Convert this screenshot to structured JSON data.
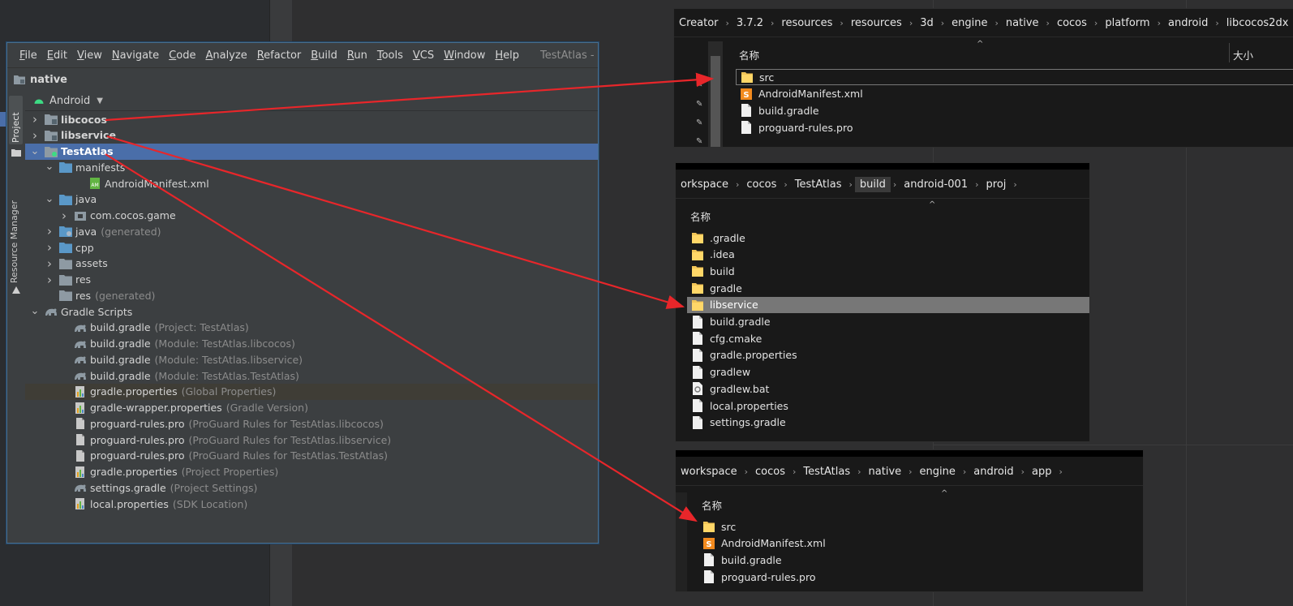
{
  "studio": {
    "menus": [
      "File",
      "Edit",
      "View",
      "Navigate",
      "Code",
      "Analyze",
      "Refactor",
      "Build",
      "Run",
      "Tools",
      "VCS",
      "Window",
      "Help"
    ],
    "window_title": "TestAtlas - libse",
    "breadcrumb": "native",
    "sidebar": {
      "project_tab": "Project",
      "resource_tab": "Resource Manager"
    },
    "view_selector": "Android",
    "tree": [
      {
        "label": "libcocos",
        "hint": "",
        "chevron": ">",
        "icon": "module",
        "bold": true,
        "indent": 0
      },
      {
        "label": "libservice",
        "hint": "",
        "chevron": ">",
        "icon": "module",
        "bold": true,
        "indent": 0
      },
      {
        "label": "TestAtlas",
        "hint": "",
        "chevron": "v",
        "icon": "app-module",
        "bold": true,
        "indent": 0,
        "selected": true
      },
      {
        "label": "manifests",
        "hint": "",
        "chevron": "v",
        "icon": "folder-blue",
        "bold": false,
        "indent": 1
      },
      {
        "label": "AndroidManifest.xml",
        "hint": "",
        "chevron": "",
        "icon": "manifest",
        "bold": false,
        "indent": 3
      },
      {
        "label": "java",
        "hint": "",
        "chevron": "v",
        "icon": "folder-blue",
        "bold": false,
        "indent": 1
      },
      {
        "label": "com.cocos.game",
        "hint": "",
        "chevron": ">",
        "icon": "package",
        "bold": false,
        "indent": 2
      },
      {
        "label": "java",
        "hint": "(generated)",
        "chevron": ">",
        "icon": "folder-gen",
        "bold": false,
        "indent": 1
      },
      {
        "label": "cpp",
        "hint": "",
        "chevron": ">",
        "icon": "folder-blue",
        "bold": false,
        "indent": 1
      },
      {
        "label": "assets",
        "hint": "",
        "chevron": ">",
        "icon": "folder",
        "bold": false,
        "indent": 1
      },
      {
        "label": "res",
        "hint": "",
        "chevron": ">",
        "icon": "folder",
        "bold": false,
        "indent": 1
      },
      {
        "label": "res",
        "hint": "(generated)",
        "chevron": "",
        "icon": "folder",
        "bold": false,
        "indent": 1
      },
      {
        "label": "Gradle Scripts",
        "hint": "",
        "chevron": "v",
        "icon": "gradle",
        "bold": false,
        "indent": 0
      },
      {
        "label": "build.gradle",
        "hint": "(Project: TestAtlas)",
        "chevron": "",
        "icon": "gradle",
        "bold": false,
        "indent": 2
      },
      {
        "label": "build.gradle",
        "hint": "(Module: TestAtlas.libcocos)",
        "chevron": "",
        "icon": "gradle",
        "bold": false,
        "indent": 2
      },
      {
        "label": "build.gradle",
        "hint": "(Module: TestAtlas.libservice)",
        "chevron": "",
        "icon": "gradle",
        "bold": false,
        "indent": 2
      },
      {
        "label": "build.gradle",
        "hint": "(Module: TestAtlas.TestAtlas)",
        "chevron": "",
        "icon": "gradle",
        "bold": false,
        "indent": 2
      },
      {
        "label": "gradle.properties",
        "hint": "(Global Properties)",
        "chevron": "",
        "icon": "props",
        "bold": false,
        "indent": 2,
        "hilite": true
      },
      {
        "label": "gradle-wrapper.properties",
        "hint": "(Gradle Version)",
        "chevron": "",
        "icon": "props",
        "bold": false,
        "indent": 2
      },
      {
        "label": "proguard-rules.pro",
        "hint": "(ProGuard Rules for TestAtlas.libcocos)",
        "chevron": "",
        "icon": "file",
        "bold": false,
        "indent": 2
      },
      {
        "label": "proguard-rules.pro",
        "hint": "(ProGuard Rules for TestAtlas.libservice)",
        "chevron": "",
        "icon": "file",
        "bold": false,
        "indent": 2
      },
      {
        "label": "proguard-rules.pro",
        "hint": "(ProGuard Rules for TestAtlas.TestAtlas)",
        "chevron": "",
        "icon": "file",
        "bold": false,
        "indent": 2
      },
      {
        "label": "gradle.properties",
        "hint": "(Project Properties)",
        "chevron": "",
        "icon": "props",
        "bold": false,
        "indent": 2
      },
      {
        "label": "settings.gradle",
        "hint": "(Project Settings)",
        "chevron": "",
        "icon": "gradle",
        "bold": false,
        "indent": 2
      },
      {
        "label": "local.properties",
        "hint": "(SDK Location)",
        "chevron": "",
        "icon": "props",
        "bold": false,
        "indent": 2
      }
    ]
  },
  "explorer1": {
    "crumbs": [
      "Creator",
      "3.7.2",
      "resources",
      "resources",
      "3d",
      "engine",
      "native",
      "cocos",
      "platform",
      "android",
      "libcocos2dx"
    ],
    "col_name": "名称",
    "col_size": "大小",
    "files": [
      {
        "name": "src",
        "icon": "folder",
        "outlined": true
      },
      {
        "name": "AndroidManifest.xml",
        "icon": "xml"
      },
      {
        "name": "build.gradle",
        "icon": "file"
      },
      {
        "name": "proguard-rules.pro",
        "icon": "file"
      }
    ]
  },
  "explorer2": {
    "crumbs": [
      "orkspace",
      "cocos",
      "TestAtlas",
      "build",
      "android-001",
      "proj"
    ],
    "active_crumb": 3,
    "col_name": "名称",
    "files": [
      {
        "name": ".gradle",
        "icon": "folder"
      },
      {
        "name": ".idea",
        "icon": "folder"
      },
      {
        "name": "build",
        "icon": "folder"
      },
      {
        "name": "gradle",
        "icon": "folder"
      },
      {
        "name": "libservice",
        "icon": "folder",
        "selected": true
      },
      {
        "name": "build.gradle",
        "icon": "file"
      },
      {
        "name": "cfg.cmake",
        "icon": "file"
      },
      {
        "name": "gradle.properties",
        "icon": "file"
      },
      {
        "name": "gradlew",
        "icon": "file"
      },
      {
        "name": "gradlew.bat",
        "icon": "bat"
      },
      {
        "name": "local.properties",
        "icon": "file"
      },
      {
        "name": "settings.gradle",
        "icon": "file"
      }
    ]
  },
  "explorer3": {
    "crumbs": [
      "workspace",
      "cocos",
      "TestAtlas",
      "native",
      "engine",
      "android",
      "app"
    ],
    "col_name": "名称",
    "files": [
      {
        "name": "src",
        "icon": "folder"
      },
      {
        "name": "AndroidManifest.xml",
        "icon": "xml"
      },
      {
        "name": "build.gradle",
        "icon": "file"
      },
      {
        "name": "proguard-rules.pro",
        "icon": "file"
      }
    ]
  },
  "colors": {
    "arrow": "#e8262a",
    "selection": "#4a6ea9",
    "android_green": "#3ddc84"
  }
}
